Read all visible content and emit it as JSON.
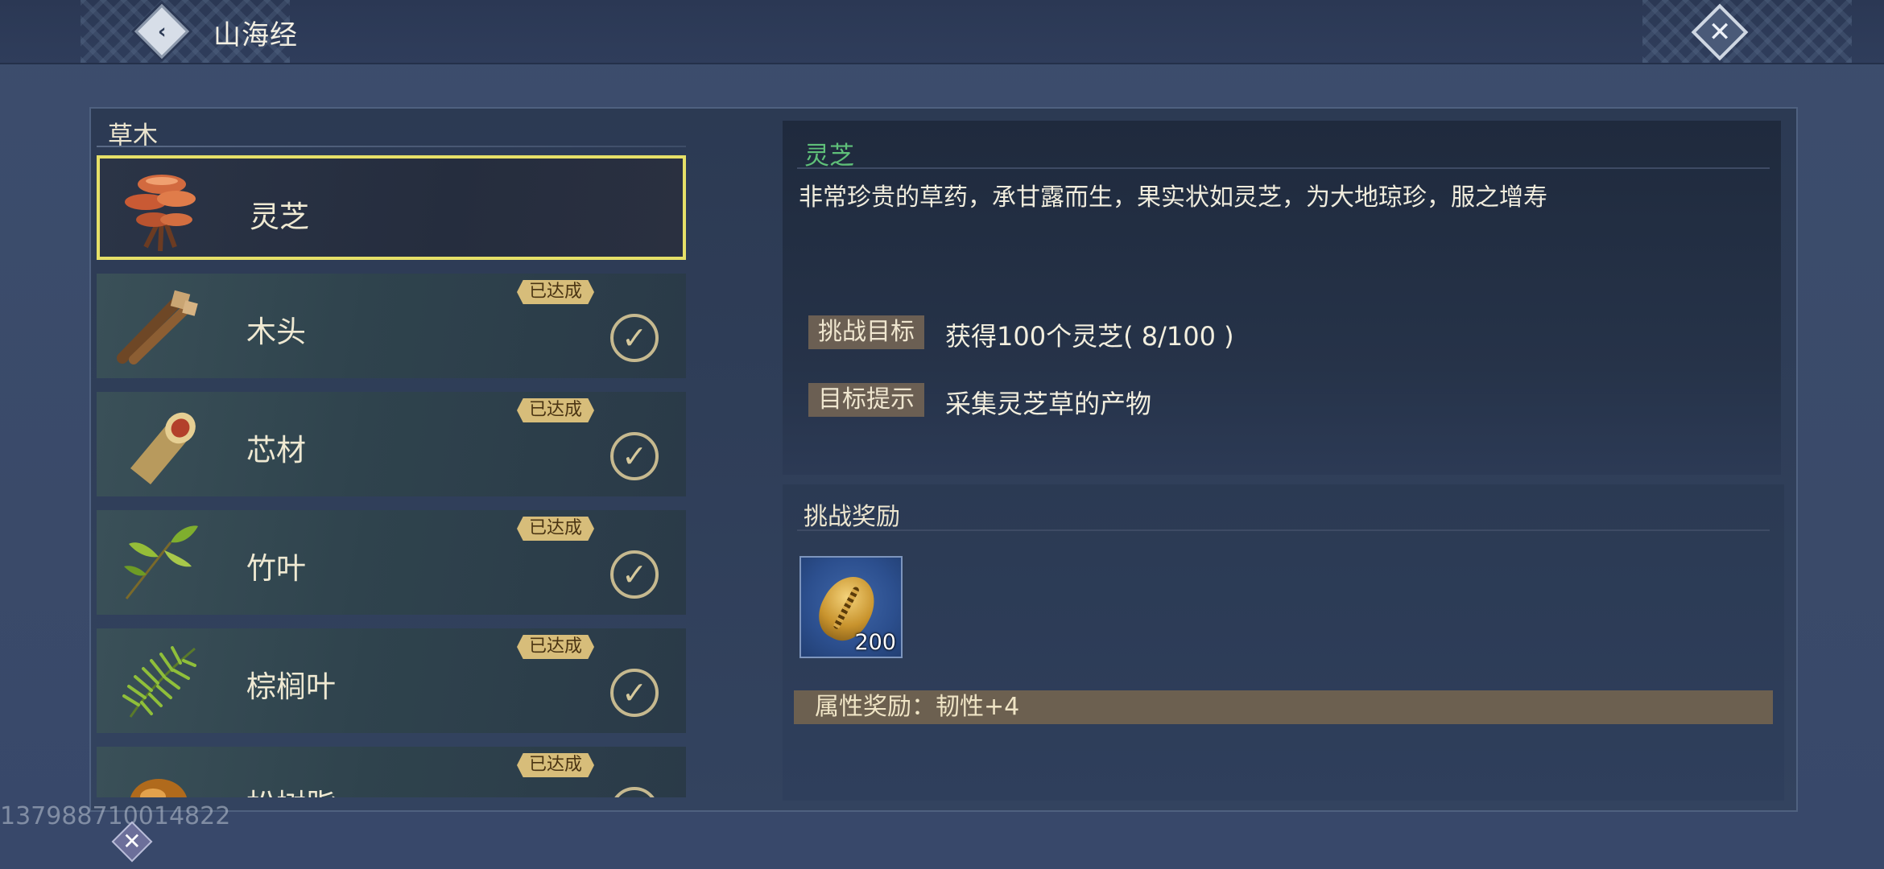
{
  "header": {
    "title": "山海经",
    "back_icon": "chevron-left-icon",
    "close_icon": "close-icon"
  },
  "category": {
    "label": "草木"
  },
  "items": [
    {
      "name": "灵芝",
      "selected": true,
      "completed": false,
      "icon": "lingzhi-mushroom-icon"
    },
    {
      "name": "木头",
      "selected": false,
      "completed": true,
      "badge": "已达成",
      "icon": "wood-log-icon"
    },
    {
      "name": "芯材",
      "selected": false,
      "completed": true,
      "badge": "已达成",
      "icon": "core-wood-icon"
    },
    {
      "name": "竹叶",
      "selected": false,
      "completed": true,
      "badge": "已达成",
      "icon": "bamboo-leaf-icon"
    },
    {
      "name": "棕榈叶",
      "selected": false,
      "completed": true,
      "badge": "已达成",
      "icon": "palm-leaf-icon"
    },
    {
      "name": "松树脂",
      "selected": false,
      "completed": true,
      "badge": "已达成",
      "icon": "pine-resin-icon"
    }
  ],
  "detail": {
    "title": "灵芝",
    "description": "非常珍贵的草药，承甘露而生，果实状如灵芝，为大地琼珍，服之增寿",
    "goal_label": "挑战目标",
    "goal_text": "获得100个灵芝( 8/100 )",
    "hint_label": "目标提示",
    "hint_text": "采集灵芝草的产物"
  },
  "reward": {
    "title": "挑战奖励",
    "item_icon": "golden-seed-icon",
    "item_quantity": "200",
    "attribute_text": "属性奖励：韧性+4"
  },
  "footer": {
    "uid": "137988710014822"
  },
  "colors": {
    "selected_border": "#e6e068",
    "detail_title": "#5fc079",
    "badge_bg": "#d7bd7a",
    "tag_bg": "#6b5f53"
  }
}
